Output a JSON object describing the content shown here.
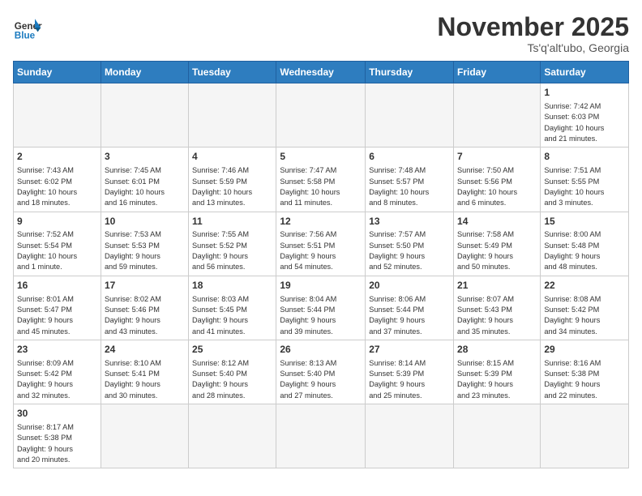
{
  "header": {
    "logo_general": "General",
    "logo_blue": "Blue",
    "title": "November 2025",
    "subtitle": "Ts'q'alt'ubo, Georgia"
  },
  "weekdays": [
    "Sunday",
    "Monday",
    "Tuesday",
    "Wednesday",
    "Thursday",
    "Friday",
    "Saturday"
  ],
  "days": [
    {
      "date": "",
      "info": ""
    },
    {
      "date": "",
      "info": ""
    },
    {
      "date": "",
      "info": ""
    },
    {
      "date": "",
      "info": ""
    },
    {
      "date": "",
      "info": ""
    },
    {
      "date": "",
      "info": ""
    },
    {
      "date": "1",
      "info": "Sunrise: 7:42 AM\nSunset: 6:03 PM\nDaylight: 10 hours\nand 21 minutes."
    },
    {
      "date": "2",
      "info": "Sunrise: 7:43 AM\nSunset: 6:02 PM\nDaylight: 10 hours\nand 18 minutes."
    },
    {
      "date": "3",
      "info": "Sunrise: 7:45 AM\nSunset: 6:01 PM\nDaylight: 10 hours\nand 16 minutes."
    },
    {
      "date": "4",
      "info": "Sunrise: 7:46 AM\nSunset: 5:59 PM\nDaylight: 10 hours\nand 13 minutes."
    },
    {
      "date": "5",
      "info": "Sunrise: 7:47 AM\nSunset: 5:58 PM\nDaylight: 10 hours\nand 11 minutes."
    },
    {
      "date": "6",
      "info": "Sunrise: 7:48 AM\nSunset: 5:57 PM\nDaylight: 10 hours\nand 8 minutes."
    },
    {
      "date": "7",
      "info": "Sunrise: 7:50 AM\nSunset: 5:56 PM\nDaylight: 10 hours\nand 6 minutes."
    },
    {
      "date": "8",
      "info": "Sunrise: 7:51 AM\nSunset: 5:55 PM\nDaylight: 10 hours\nand 3 minutes."
    },
    {
      "date": "9",
      "info": "Sunrise: 7:52 AM\nSunset: 5:54 PM\nDaylight: 10 hours\nand 1 minute."
    },
    {
      "date": "10",
      "info": "Sunrise: 7:53 AM\nSunset: 5:53 PM\nDaylight: 9 hours\nand 59 minutes."
    },
    {
      "date": "11",
      "info": "Sunrise: 7:55 AM\nSunset: 5:52 PM\nDaylight: 9 hours\nand 56 minutes."
    },
    {
      "date": "12",
      "info": "Sunrise: 7:56 AM\nSunset: 5:51 PM\nDaylight: 9 hours\nand 54 minutes."
    },
    {
      "date": "13",
      "info": "Sunrise: 7:57 AM\nSunset: 5:50 PM\nDaylight: 9 hours\nand 52 minutes."
    },
    {
      "date": "14",
      "info": "Sunrise: 7:58 AM\nSunset: 5:49 PM\nDaylight: 9 hours\nand 50 minutes."
    },
    {
      "date": "15",
      "info": "Sunrise: 8:00 AM\nSunset: 5:48 PM\nDaylight: 9 hours\nand 48 minutes."
    },
    {
      "date": "16",
      "info": "Sunrise: 8:01 AM\nSunset: 5:47 PM\nDaylight: 9 hours\nand 45 minutes."
    },
    {
      "date": "17",
      "info": "Sunrise: 8:02 AM\nSunset: 5:46 PM\nDaylight: 9 hours\nand 43 minutes."
    },
    {
      "date": "18",
      "info": "Sunrise: 8:03 AM\nSunset: 5:45 PM\nDaylight: 9 hours\nand 41 minutes."
    },
    {
      "date": "19",
      "info": "Sunrise: 8:04 AM\nSunset: 5:44 PM\nDaylight: 9 hours\nand 39 minutes."
    },
    {
      "date": "20",
      "info": "Sunrise: 8:06 AM\nSunset: 5:44 PM\nDaylight: 9 hours\nand 37 minutes."
    },
    {
      "date": "21",
      "info": "Sunrise: 8:07 AM\nSunset: 5:43 PM\nDaylight: 9 hours\nand 35 minutes."
    },
    {
      "date": "22",
      "info": "Sunrise: 8:08 AM\nSunset: 5:42 PM\nDaylight: 9 hours\nand 34 minutes."
    },
    {
      "date": "23",
      "info": "Sunrise: 8:09 AM\nSunset: 5:42 PM\nDaylight: 9 hours\nand 32 minutes."
    },
    {
      "date": "24",
      "info": "Sunrise: 8:10 AM\nSunset: 5:41 PM\nDaylight: 9 hours\nand 30 minutes."
    },
    {
      "date": "25",
      "info": "Sunrise: 8:12 AM\nSunset: 5:40 PM\nDaylight: 9 hours\nand 28 minutes."
    },
    {
      "date": "26",
      "info": "Sunrise: 8:13 AM\nSunset: 5:40 PM\nDaylight: 9 hours\nand 27 minutes."
    },
    {
      "date": "27",
      "info": "Sunrise: 8:14 AM\nSunset: 5:39 PM\nDaylight: 9 hours\nand 25 minutes."
    },
    {
      "date": "28",
      "info": "Sunrise: 8:15 AM\nSunset: 5:39 PM\nDaylight: 9 hours\nand 23 minutes."
    },
    {
      "date": "29",
      "info": "Sunrise: 8:16 AM\nSunset: 5:38 PM\nDaylight: 9 hours\nand 22 minutes."
    },
    {
      "date": "30",
      "info": "Sunrise: 8:17 AM\nSunset: 5:38 PM\nDaylight: 9 hours\nand 20 minutes."
    },
    {
      "date": "",
      "info": ""
    },
    {
      "date": "",
      "info": ""
    },
    {
      "date": "",
      "info": ""
    },
    {
      "date": "",
      "info": ""
    },
    {
      "date": "",
      "info": ""
    },
    {
      "date": "",
      "info": ""
    }
  ]
}
